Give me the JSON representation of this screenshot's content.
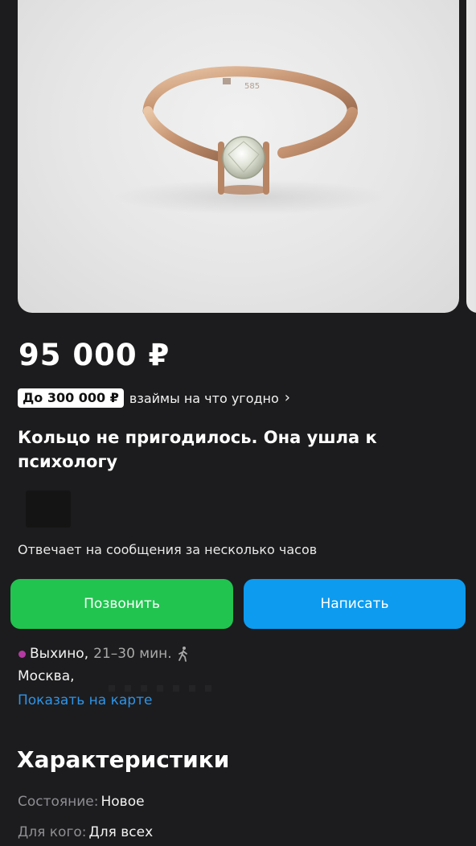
{
  "listing": {
    "price": "95 000 ₽",
    "loan_badge": "До 300 000 ₽",
    "loan_text": "взаймы на что угодно",
    "title": "Кольцо не пригодилось. Она ушла к психологу"
  },
  "seller": {
    "reply_info": "Отвечает на сообщения за несколько часов"
  },
  "actions": {
    "call_label": "Позвонить",
    "write_label": "Написать"
  },
  "location": {
    "metro_station": "Выхино,",
    "metro_time": "21–30 мин.",
    "city": "Москва,",
    "map_link": "Показать на карте"
  },
  "characteristics": {
    "heading": "Характеристики",
    "items": [
      {
        "key": "Состояние:",
        "value": "Новое"
      },
      {
        "key": "Для кого:",
        "value": "Для всех"
      }
    ]
  },
  "icons": {
    "loan_chevron": "chevron-right-icon",
    "metro_dot": "metro-line-dot",
    "walk": "walking-person-icon"
  },
  "colors": {
    "background": "#1c1c1e",
    "call_button": "#21c44f",
    "write_button": "#0d9bef",
    "metro_line": "#b43aa3",
    "map_link": "#2e94e8"
  }
}
